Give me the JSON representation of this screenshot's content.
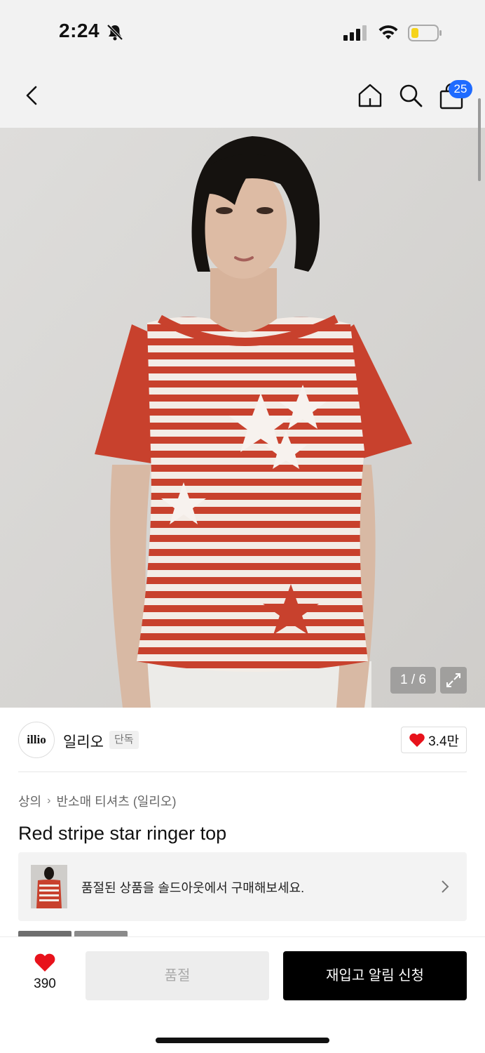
{
  "status_bar": {
    "time": "2:24"
  },
  "header": {
    "cart_count": "25"
  },
  "gallery": {
    "counter": "1 / 6"
  },
  "brand": {
    "logo_text": "illio",
    "name": "일리오",
    "tag": "단독",
    "likes": "3.4만"
  },
  "breadcrumb": {
    "items": [
      "상의",
      "반소매 티셔츠 (일리오)"
    ]
  },
  "product": {
    "title": "Red stripe star ringer top"
  },
  "soldout_banner": {
    "text": "품절된 상품을 솔드아웃에서 구매해보세요."
  },
  "bottom_bar": {
    "wish_count": "390",
    "soldout_label": "품절",
    "restock_label": "재입고 알림 신청"
  },
  "colors": {
    "accent_blue": "#1f6bff",
    "heart_red": "#e8121b",
    "shirt_red": "#c8412d"
  }
}
